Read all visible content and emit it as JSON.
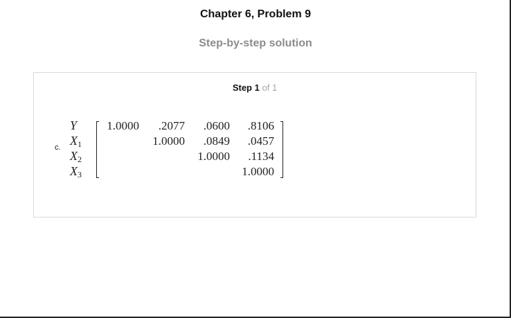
{
  "header": {
    "title": "Chapter 6, Problem 9",
    "subtitle": "Step-by-step solution"
  },
  "step": {
    "label": "Step",
    "number": "1",
    "total_text": "of 1"
  },
  "solution": {
    "part_label": "c.",
    "row_labels": [
      {
        "var": "Y",
        "sub": ""
      },
      {
        "var": "X",
        "sub": "1"
      },
      {
        "var": "X",
        "sub": "2"
      },
      {
        "var": "X",
        "sub": "3"
      }
    ],
    "matrix": [
      [
        "1.0000",
        ".2077",
        ".0600",
        ".8106"
      ],
      [
        "",
        "1.0000",
        ".0849",
        ".0457"
      ],
      [
        "",
        "",
        "1.0000",
        ".1134"
      ],
      [
        "",
        "",
        "",
        "1.0000"
      ]
    ]
  }
}
